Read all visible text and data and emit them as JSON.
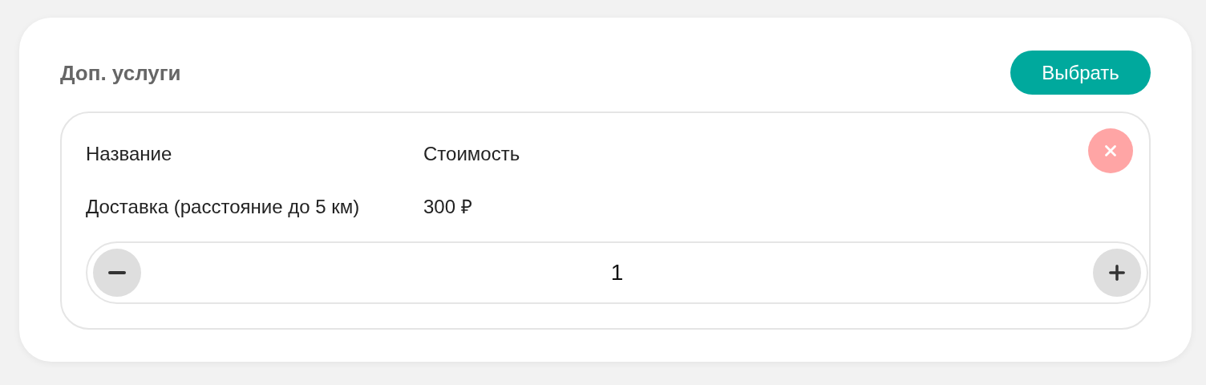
{
  "title": "Доп. услуги",
  "select_button": "Выбрать",
  "service": {
    "columns": [
      "Название",
      "Стоимость"
    ],
    "name": "Доставка (расстояние до 5 км)",
    "price": "300 ₽",
    "quantity": "1"
  }
}
